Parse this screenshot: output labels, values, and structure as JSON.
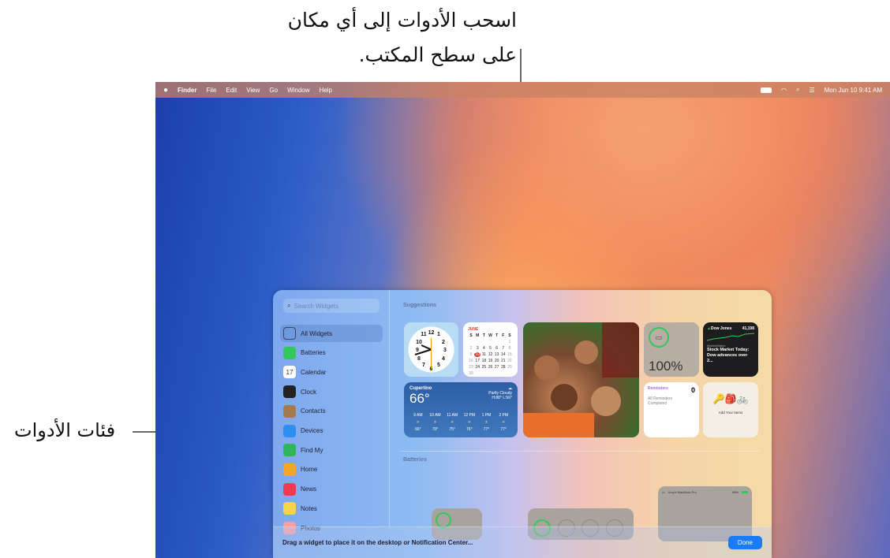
{
  "callouts": {
    "top_line1": "اسحب الأدوات إلى أي مكان",
    "top_line2": "على سطح المكتب.",
    "left": "فئات الأدوات"
  },
  "menubar": {
    "app": "Finder",
    "items": [
      "File",
      "Edit",
      "View",
      "Go",
      "Window",
      "Help"
    ],
    "datetime": "Mon Jun 10  9:41 AM"
  },
  "sidebar": {
    "search_placeholder": "Search Widgets",
    "items": [
      {
        "label": "All Widgets",
        "icon": "all-widgets-icon",
        "color": "#5a7ab8"
      },
      {
        "label": "Batteries",
        "icon": "batteries-icon",
        "color": "#34c759"
      },
      {
        "label": "Calendar",
        "icon": "calendar-icon",
        "color": "#ffffff"
      },
      {
        "label": "Clock",
        "icon": "clock-icon",
        "color": "#222222"
      },
      {
        "label": "Contacts",
        "icon": "contacts-icon",
        "color": "#a67a4a"
      },
      {
        "label": "Devices",
        "icon": "devices-icon",
        "color": "#2f8ff0"
      },
      {
        "label": "Find My",
        "icon": "find-my-icon",
        "color": "#30b55a"
      },
      {
        "label": "Home",
        "icon": "home-icon",
        "color": "#f5a623"
      },
      {
        "label": "News",
        "icon": "news-icon",
        "color": "#f03a52"
      },
      {
        "label": "Notes",
        "icon": "notes-icon",
        "color": "#f7d54a"
      },
      {
        "label": "Photos",
        "icon": "photos-icon",
        "color": "#f7a0a0"
      }
    ]
  },
  "sections": {
    "suggestions": "Suggestions",
    "batteries": "Batteries"
  },
  "calendar": {
    "month": "JUNE",
    "days": [
      "S",
      "M",
      "T",
      "W",
      "T",
      "F",
      "S"
    ],
    "dates": [
      "",
      "",
      "",
      "",
      "",
      "",
      "1",
      "2",
      "3",
      "4",
      "5",
      "6",
      "7",
      "8",
      "9",
      "10",
      "11",
      "12",
      "13",
      "14",
      "15",
      "16",
      "17",
      "18",
      "19",
      "20",
      "21",
      "22",
      "23",
      "24",
      "25",
      "26",
      "27",
      "28",
      "29",
      "30"
    ],
    "today": "10",
    "calendar_icon_day": "17"
  },
  "weather": {
    "city": "Cupertino",
    "temp": "66°",
    "condition": "Partly Cloudy",
    "hilo": "H:88° L:56°",
    "hours": [
      {
        "t": "9 AM",
        "v": "66°"
      },
      {
        "t": "10 AM",
        "v": "70°"
      },
      {
        "t": "11 AM",
        "v": "75°"
      },
      {
        "t": "12 PM",
        "v": "76°"
      },
      {
        "t": "1 PM",
        "v": "77°"
      },
      {
        "t": "2 PM",
        "v": "77°"
      }
    ]
  },
  "battery": {
    "percent": "100%",
    "level": 1.0
  },
  "stocks": {
    "symbol": "Dow Jones",
    "value": "41,198",
    "source": "MarketWatch",
    "headline": "Stock Market Today: Dow advances over 2..."
  },
  "reminders": {
    "title": "Reminders",
    "count": "0",
    "status": "All Reminders Completed"
  },
  "findmy": {
    "label": "Add Your Items"
  },
  "battery_list": {
    "device": "Amy's MacBook Pro",
    "percent": "98%"
  },
  "footer": {
    "hint": "Drag a widget to place it on the desktop or Notification Center...",
    "done": "Done"
  },
  "colors": {
    "accent": "#1a7af8",
    "battery_ring": "#34c759",
    "today": "#e8332a"
  }
}
